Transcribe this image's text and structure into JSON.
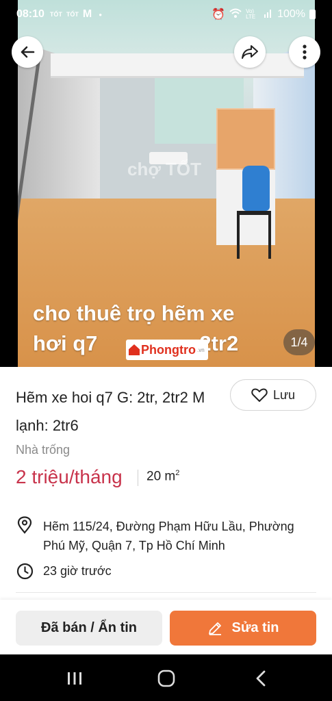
{
  "status_bar": {
    "time": "08:10",
    "notif_1": "TỐT",
    "notif_2": "TỐT",
    "mail_letter": "M",
    "net_label": "Vo) LTE",
    "battery": "100%"
  },
  "gallery": {
    "caption_line1": "cho thuê trọ hẽm xe",
    "caption_line2": "hơi q7",
    "caption_line2_end": "- 2tr2",
    "watermark_brand": "Phongtro",
    "watermark_domain": ".vn",
    "watermark_faint": "chợ TỐT",
    "counter": "1/4"
  },
  "icons": {
    "back": "arrow-left-icon",
    "share": "share-icon",
    "more": "more-vertical-icon",
    "heart": "heart-icon",
    "location": "location-pin-icon",
    "clock": "clock-icon",
    "edit": "pencil-icon"
  },
  "listing": {
    "title": "Hẽm xe hoi q7 G: 2tr, 2tr2 M lạnh: 2tr6",
    "save_label": "Lưu",
    "category": "Nhà trống",
    "price": "2 triệu/tháng",
    "area_value": "20 m",
    "area_unit_sup": "2",
    "address": "Hẽm 115/24, Đường Phạm Hữu Lầu, Phường Phú Mỹ, Quận 7, Tp Hồ Chí Minh",
    "posted": "23 giờ trước"
  },
  "actions": {
    "sold_label": "Đã bán / Ẩn tin",
    "edit_label": "Sửa tin"
  },
  "colors": {
    "price": "#c8334b",
    "edit_button": "#f0773a"
  }
}
